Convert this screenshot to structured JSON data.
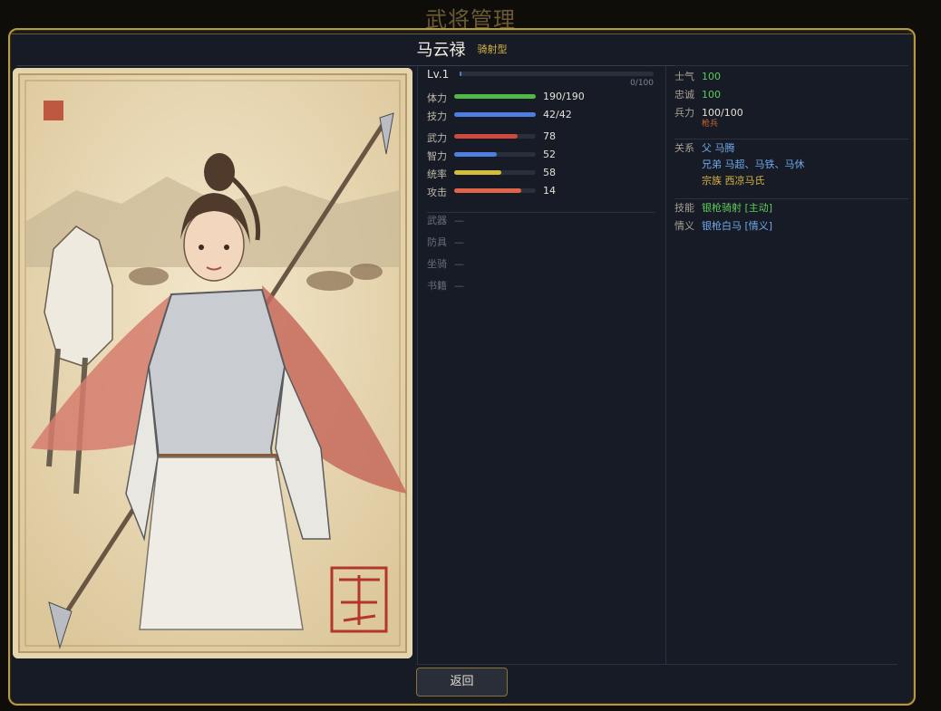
{
  "page": {
    "title": "武将管理"
  },
  "hero": {
    "name": "马云禄",
    "type": "骑射型"
  },
  "level": {
    "label": "Lv.1",
    "exp_text": "0/100",
    "exp_ratio": 0.0
  },
  "bars": [
    {
      "label": "体力",
      "value": "190/190",
      "ratio": 1.0,
      "color": "#4fb848"
    },
    {
      "label": "技力",
      "value": "42/42",
      "ratio": 1.0,
      "color": "#4f7ee0"
    }
  ],
  "attributes": [
    {
      "label": "武力",
      "value": "78",
      "ratio": 0.78,
      "color": "#d0483e"
    },
    {
      "label": "智力",
      "value": "52",
      "ratio": 0.52,
      "color": "#4f7ee0"
    },
    {
      "label": "统率",
      "value": "58",
      "ratio": 0.58,
      "color": "#d2be3a"
    },
    {
      "label": "攻击",
      "value": "14",
      "ratio": 0.82,
      "color": "#e0634a"
    }
  ],
  "equipment": [
    {
      "label": "武器",
      "value": "—"
    },
    {
      "label": "防具",
      "value": "—"
    },
    {
      "label": "坐骑",
      "value": "—"
    },
    {
      "label": "书籍",
      "value": "—"
    }
  ],
  "status": {
    "morale": {
      "label": "士气",
      "value": "100"
    },
    "loyalty": {
      "label": "忠诚",
      "value": "100"
    },
    "troops": {
      "label": "兵力",
      "value": "100/100",
      "unit": "枪兵"
    }
  },
  "relations": {
    "label": "关系",
    "items": [
      "父 马腾",
      "兄弟 马超、马铁、马休",
      "宗族 西凉马氏"
    ]
  },
  "skills": {
    "label": "技能",
    "value": "银枪骑射 [主动]"
  },
  "bond": {
    "label": "情义",
    "value": "银枪白马 [情义]"
  },
  "actions": {
    "back_label": "返回"
  },
  "colors": {
    "accent_gold": "#b89a3e",
    "panel_bg": "#171b26"
  }
}
